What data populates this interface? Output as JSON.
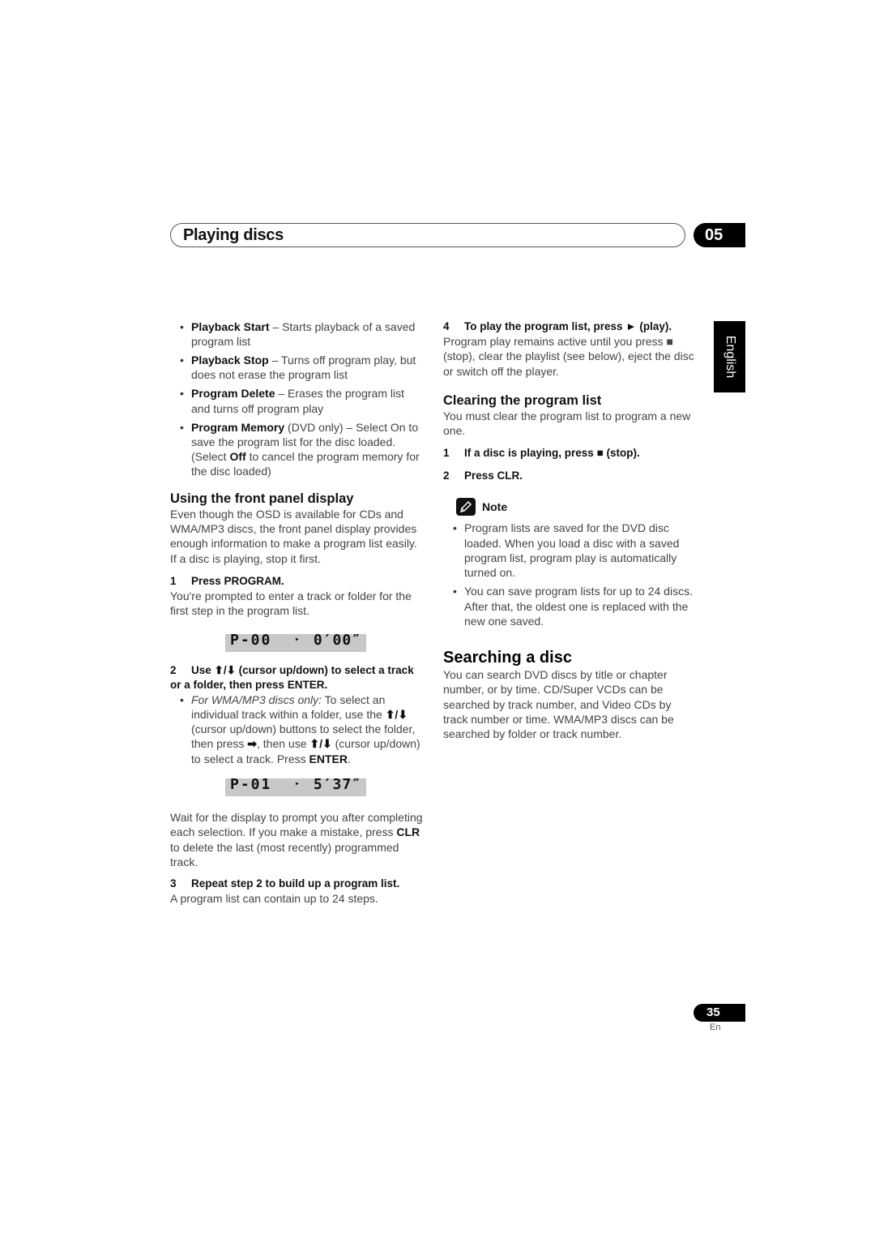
{
  "header": {
    "title": "Playing discs",
    "chapter": "05"
  },
  "language_tab": "English",
  "left": {
    "bullets": [
      {
        "term": "Playback Start",
        "text": " – Starts playback of a saved program list"
      },
      {
        "term": "Playback Stop",
        "text": " – Turns off program play, but does not erase the program list"
      },
      {
        "term": "Program Delete",
        "text": " – Erases the program list and turns off program play"
      },
      {
        "term": "Program Memory",
        "text_a": " (DVD only) – Select On to save the program list for the disc loaded. (Select ",
        "term2": "Off",
        "text_b": " to cancel the program memory for the disc loaded)"
      }
    ],
    "front_panel": {
      "heading": "Using the front panel display",
      "intro": "Even though the OSD is available for CDs and WMA/MP3 discs, the front panel display provides enough information to make a program list easily. If a disc is playing, stop it first.",
      "step1": {
        "num": "1",
        "label": "Press PROGRAM.",
        "body": "You're prompted to enter a track or folder for the first step in the program list."
      },
      "display1": {
        "left": "P-00",
        "mid": "▸",
        "right": "0′00″"
      },
      "step2": {
        "num": "2",
        "label_a": "Use ",
        "arrows": "⬆/⬇",
        "label_b": " (cursor up/down) to select a track or a folder, then press ENTER."
      },
      "step2_bullet": {
        "italic": "For WMA/MP3 discs only:",
        "text_a": " To select an individual track within a folder, use the ",
        "arrows1": "⬆/⬇",
        "text_b": " (cursor up/down) buttons to select the folder, then press ",
        "arrow_right": "➡",
        "text_c": ", then use ",
        "arrows2": "⬆/⬇",
        "text_d": " (cursor up/down) to select a track. Press ",
        "bold_end": "ENTER",
        "text_e": "."
      },
      "display2": {
        "left": "P-01",
        "mid": "▸",
        "right": "5′37″"
      },
      "wait_text_a": "Wait for the display to prompt you after completing each selection. If you make a mistake, press ",
      "wait_bold": "CLR",
      "wait_text_b": " to delete the last (most recently) programmed track.",
      "step3": {
        "num": "3",
        "label": "Repeat step 2 to build up a program list.",
        "body": "A program list can contain up to 24 steps."
      }
    }
  },
  "right": {
    "step4": {
      "num": "4",
      "label": "To play the program list, press ► (play).",
      "body": "Program play remains active until you press ■ (stop), clear the playlist (see below), eject the disc or switch off the player."
    },
    "clearing": {
      "heading": "Clearing the program list",
      "intro": "You must clear the program list to program a new one.",
      "steps": [
        {
          "num": "1",
          "label": "If a disc is playing, press ■ (stop)."
        },
        {
          "num": "2",
          "label": "Press CLR."
        }
      ]
    },
    "note": {
      "label": "Note",
      "items": [
        "Program lists are saved for the DVD disc loaded. When you load a disc with a saved program list, program play is automatically turned on.",
        "You can save program lists for up to 24 discs. After that, the oldest one is replaced with the new one saved."
      ]
    },
    "searching": {
      "heading": "Searching a disc",
      "body": "You can search DVD discs by title or chapter number, or by time. CD/Super VCDs can be searched by track number, and Video CDs by track number or time. WMA/MP3 discs can be searched by folder or track number."
    }
  },
  "footer": {
    "page_number": "35",
    "page_lang": "En"
  }
}
